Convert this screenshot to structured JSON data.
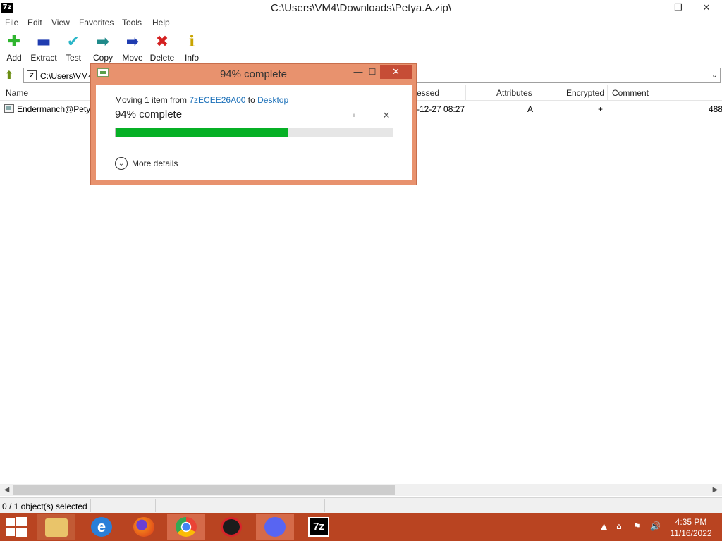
{
  "window": {
    "app_icon_text": "7z",
    "title": "C:\\Users\\VM4\\Downloads\\Petya.A.zip\\",
    "controls": {
      "minimize": "—",
      "maximize": "❐",
      "close": "✕"
    }
  },
  "menu": [
    "File",
    "Edit",
    "View",
    "Favorites",
    "Tools",
    "Help"
  ],
  "toolbar": [
    {
      "label": "Add",
      "icon": "plus-icon",
      "glyph": "✚",
      "color": "#2fb52f"
    },
    {
      "label": "Extract",
      "icon": "minus-icon",
      "glyph": "▬",
      "color": "#1f3cb0"
    },
    {
      "label": "Test",
      "icon": "check-icon",
      "glyph": "✔",
      "color": "#2bb6c8"
    },
    {
      "label": "Copy",
      "icon": "copy-arrow-icon",
      "glyph": "➡",
      "color": "#1f8a8a"
    },
    {
      "label": "Move",
      "icon": "move-arrow-icon",
      "glyph": "➡",
      "color": "#1f3cb0"
    },
    {
      "label": "Delete",
      "icon": "delete-x-icon",
      "glyph": "✖",
      "color": "#d42020"
    },
    {
      "label": "Info",
      "icon": "info-icon",
      "glyph": "ℹ",
      "color": "#c8a400"
    }
  ],
  "address": {
    "path": "C:\\Users\\VM4",
    "up_glyph": "⬆",
    "dropdown_glyph": "⌄"
  },
  "columns": {
    "name": "Name",
    "accessed": "essed",
    "attributes": "Attributes",
    "encrypted": "Encrypted",
    "comment": "Comment"
  },
  "file": {
    "name": "Endermanch@Petya",
    "accessed": "-12-27 08:27",
    "attributes": "A",
    "encrypted": "+",
    "trailing": "488"
  },
  "status": {
    "selected": "0 / 1 object(s) selected"
  },
  "dialog": {
    "title": "94% complete",
    "moving_prefix": "Moving 1 item from ",
    "source": "7zECEE26A00",
    "moving_mid": " to ",
    "destination": "Desktop",
    "percent_text": "94% complete",
    "progress": 0.62,
    "more_details": "More details",
    "controls": {
      "minimize": "—",
      "maximize": "☐",
      "close": "✕",
      "pause": "⏸",
      "stop": "✕"
    }
  },
  "taskbar": {
    "apps": [
      "file-explorer",
      "internet-explorer",
      "firefox",
      "chrome",
      "app-red",
      "discord",
      "7zip"
    ],
    "active_index": 3,
    "time": "4:35 PM",
    "date": "11/16/2022",
    "colors": {
      "bar": "#b94421",
      "active": "#d56a49"
    }
  }
}
